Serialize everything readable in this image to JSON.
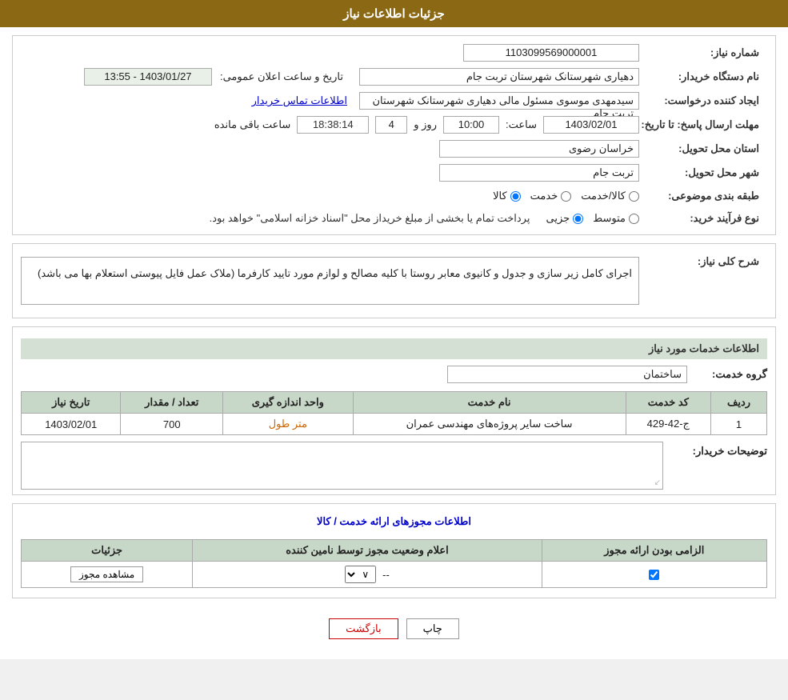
{
  "header": {
    "title": "جزئیات اطلاعات نیاز"
  },
  "fields": {
    "need_number_label": "شماره نیاز:",
    "need_number_value": "1103099569000001",
    "buyer_org_label": "نام دستگاه خریدار:",
    "buyer_org_value": "دهیاری  شهرستانک  شهرستان تربت جام",
    "creator_label": "ایجاد کننده درخواست:",
    "creator_value": "سیدمهدی موسوی مسئول مالی دهیاری  شهرستانک  شهرستان تربت جام",
    "contact_link": "اطلاعات تماس خریدار",
    "deadline_label": "مهلت ارسال پاسخ: تا تاریخ:",
    "announce_label": "تاریخ و ساعت اعلان عمومی:",
    "announce_value": "1403/01/27 - 13:55",
    "date_value": "1403/02/01",
    "time_label": "ساعت:",
    "time_value": "10:00",
    "days_label": "روز و",
    "days_value": "4",
    "remaining_label": "ساعت باقی مانده",
    "remaining_value": "18:38:14",
    "province_label": "استان محل تحویل:",
    "province_value": "خراسان رضوی",
    "city_label": "شهر محل تحویل:",
    "city_value": "تربت جام",
    "category_label": "طبقه بندی موضوعی:",
    "category_options": [
      "کالا",
      "خدمت",
      "کالا/خدمت"
    ],
    "category_selected": "کالا",
    "process_label": "نوع فرآیند خرید:",
    "process_options": [
      "جزیی",
      "متوسط"
    ],
    "process_note": "پرداخت تمام یا بخشی از مبلغ خریداز محل \"اسناد خزانه اسلامی\" خواهد بود.",
    "description_label": "شرح کلی نیاز:",
    "description_value": "اجرای کامل زیر سازی و جدول و کانیوی معابر روستا با کلیه مصالح و لوازم مورد تایید کارفرما (ملاک عمل فایل پیوستی استعلام بها می باشد)"
  },
  "services_section": {
    "title": "اطلاعات خدمات مورد نیاز",
    "group_label": "گروه خدمت:",
    "group_value": "ساختمان",
    "table_headers": [
      "ردیف",
      "کد خدمت",
      "نام خدمت",
      "واحد اندازه گیری",
      "تعداد / مقدار",
      "تاریخ نیاز"
    ],
    "table_rows": [
      {
        "row": "1",
        "code": "ج-42-429",
        "name": "ساخت سایر پروژه‌های مهندسی عمران",
        "unit": "متر طول",
        "quantity": "700",
        "date": "1403/02/01"
      }
    ]
  },
  "buyer_description": {
    "label": "توضیحات خریدار:",
    "value": ""
  },
  "license_section": {
    "title": "اطلاعات مجوزهای ارائه خدمت / کالا",
    "table_headers": [
      "الزامی بودن ارائه مجوز",
      "اعلام وضعیت مجوز توسط نامین کننده",
      "جزئیات"
    ],
    "table_rows": [
      {
        "required": true,
        "status": "--",
        "details_btn": "مشاهده مجوز"
      }
    ]
  },
  "footer": {
    "print_btn": "چاپ",
    "back_btn": "بازگشت"
  }
}
